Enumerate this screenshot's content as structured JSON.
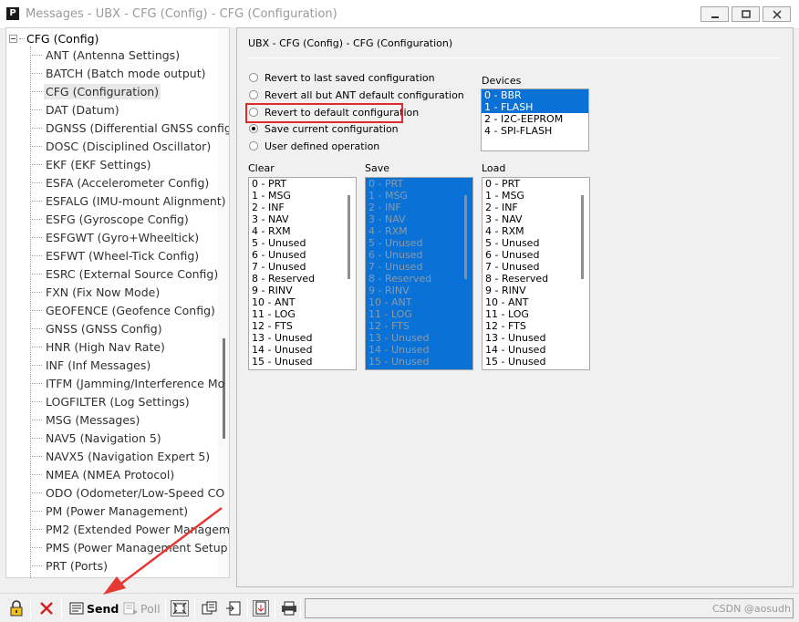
{
  "window": {
    "app_icon_letter": "P",
    "title": "Messages - UBX - CFG (Config) - CFG (Configuration)"
  },
  "tree": {
    "root_label": "CFG (Config)",
    "selected_index": 2,
    "items": [
      "ANT (Antenna Settings)",
      "BATCH (Batch mode output)",
      "CFG (Configuration)",
      "DAT (Datum)",
      "DGNSS (Differential GNSS config",
      "DOSC (Disciplined Oscillator)",
      "EKF (EKF Settings)",
      "ESFA (Accelerometer Config)",
      "ESFALG (IMU-mount Alignment)",
      "ESFG (Gyroscope Config)",
      "ESFGWT (Gyro+Wheeltick)",
      "ESFWT (Wheel-Tick Config)",
      "ESRC (External Source Config)",
      "FXN (Fix Now Mode)",
      "GEOFENCE (Geofence Config)",
      "GNSS (GNSS Config)",
      "HNR (High Nav Rate)",
      "INF (Inf Messages)",
      "ITFM (Jamming/Interference Mo",
      "LOGFILTER (Log Settings)",
      "MSG (Messages)",
      "NAV5 (Navigation 5)",
      "NAVX5 (Navigation Expert 5)",
      "NMEA (NMEA Protocol)",
      "ODO (Odometer/Low-Speed CO",
      "PM (Power Management)",
      "PM2 (Extended Power Managem",
      "PMS (Power Management Setup",
      "PRT (Ports)"
    ]
  },
  "panel": {
    "title": "UBX - CFG (Config) - CFG (Configuration)",
    "options": [
      {
        "label": "Revert to last saved configuration",
        "checked": false
      },
      {
        "label": "Revert all but ANT default configuration",
        "checked": false
      },
      {
        "label": "Revert to default configuration",
        "checked": false
      },
      {
        "label": "Save current configuration",
        "checked": true
      },
      {
        "label": "User defined operation",
        "checked": false
      }
    ],
    "devices_label": "Devices",
    "devices": [
      {
        "label": "0 - BBR",
        "selected": true
      },
      {
        "label": "1 - FLASH",
        "selected": true
      },
      {
        "label": "2 - I2C-EEPROM",
        "selected": false
      },
      {
        "label": "4 - SPI-FLASH",
        "selected": false
      }
    ],
    "clear_label": "Clear",
    "save_label": "Save",
    "load_label": "Load",
    "sections": [
      "0 - PRT",
      "1 - MSG",
      "2 - INF",
      "3 - NAV",
      "4 - RXM",
      "5 - Unused",
      "6 - Unused",
      "7 - Unused",
      "8 - Reserved",
      "9 - RINV",
      "10 - ANT",
      "11 - LOG",
      "12 - FTS",
      "13 - Unused",
      "14 - Unused",
      "15 - Unused"
    ]
  },
  "toolbar": {
    "send_label": "Send",
    "poll_label": "Poll",
    "icons": [
      "lock-icon",
      "delete-icon",
      "send-icon",
      "poll-icon",
      "auto-poll-icon",
      "copy-icon",
      "import-icon",
      "export-icon",
      "print-icon"
    ]
  },
  "watermark": "CSDN @aosudh",
  "colors": {
    "selection": "#0a72d6",
    "highlight_border": "#e32a2a",
    "annotation_arrow": "#e53935"
  }
}
